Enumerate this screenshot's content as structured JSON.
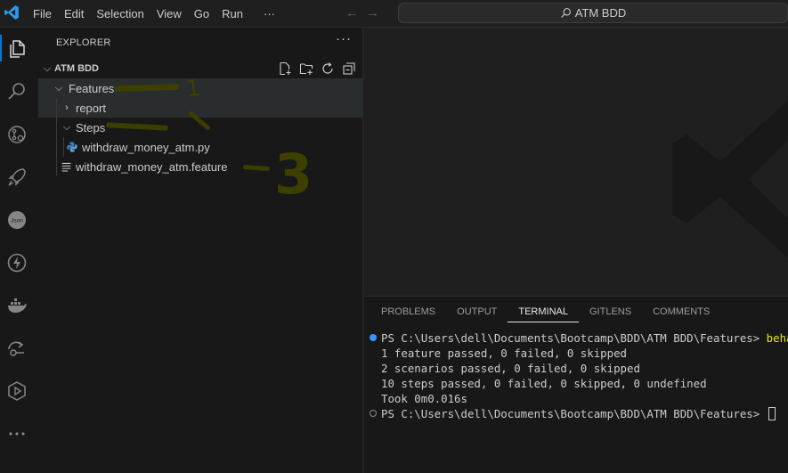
{
  "titlebar": {
    "menu": [
      "File",
      "Edit",
      "Selection",
      "View",
      "Go",
      "Run"
    ],
    "more": "···",
    "back_icon": "←",
    "forward_icon": "→",
    "search_text": "ATM BDD"
  },
  "sidebar": {
    "title": "EXPLORER",
    "more": "···",
    "root": "ATM BDD",
    "tree": {
      "features": "Features",
      "report": "report",
      "steps": "Steps",
      "py_file": "withdraw_money_atm.py",
      "feature_file": "withdraw_money_atm.feature"
    },
    "annotations": {
      "one": "1",
      "three": "3"
    }
  },
  "panel": {
    "tabs": [
      "PROBLEMS",
      "OUTPUT",
      "TERMINAL",
      "GITLENS",
      "COMMENTS"
    ],
    "active_tab": "TERMINAL",
    "terminal": {
      "prompt1": "PS C:\\Users\\dell\\Documents\\Bootcamp\\BDD\\ATM BDD\\Features> ",
      "command": "behave",
      "out1": "1 feature passed, 0 failed, 0 skipped",
      "out2": "2 scenarios passed, 0 failed, 0 skipped",
      "out3": "10 steps passed, 0 failed, 0 skipped, 0 undefined",
      "out4": "Took 0m0.016s",
      "prompt2": "PS C:\\Users\\dell\\Documents\\Bootcamp\\BDD\\ATM BDD\\Features> "
    }
  },
  "colors": {
    "accent": "#0078d4",
    "annotation": "#3d3f00",
    "command": "#e5e510",
    "success_dot": "#3794ff"
  }
}
